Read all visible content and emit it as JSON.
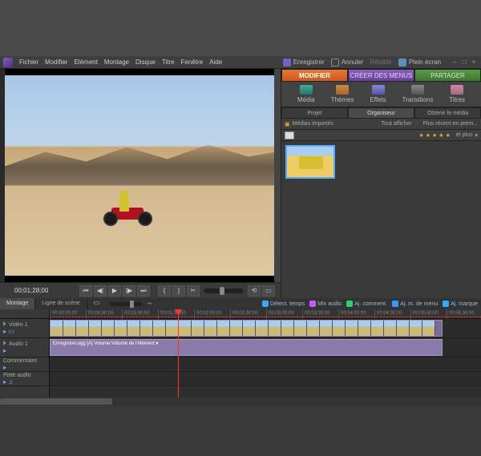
{
  "menu": {
    "items": [
      "Fichier",
      "Modifier",
      "Elément",
      "Montage",
      "Disque",
      "Titre",
      "Fenêtre",
      "Aide"
    ],
    "save": "Enregistrer",
    "undo": "Annuler",
    "redo": "Rétablir",
    "fullscreen": "Plein écran"
  },
  "preview": {
    "timecode": "00;01;28;00",
    "transport": {
      "prev": "⏮",
      "stepback": "◀|",
      "play": "▶",
      "stepfwd": "|▶",
      "next": "⏭",
      "in": "{",
      "out": "}",
      "split": "✂"
    }
  },
  "side": {
    "main_tabs": {
      "modify": "MODIFIER",
      "menus": "CRÉER DES MENUS",
      "share": "PARTAGER"
    },
    "tools": {
      "media": "Média",
      "themes": "Thèmes",
      "effects": "Effets",
      "transitions": "Transitions",
      "titles": "Titres"
    },
    "subtabs": {
      "project": "Projet",
      "organizer": "Organiseur",
      "get": "Obtenir le média"
    },
    "filter": {
      "imported": "Médias importés",
      "showall": "Tout afficher",
      "recent": "Plus récent en prem...",
      "more": "et plus"
    }
  },
  "timeline": {
    "tabs": {
      "montage": "Montage",
      "scene": "Ligne de scène"
    },
    "tools": {
      "detect": "Détect. temps",
      "mix": "Mix audio",
      "comment": "Aj. comment.",
      "menumark": "Aj. m. de menu",
      "marker": "Aj. marque"
    },
    "ruler": [
      "00;00;00;00",
      "00;00;30;00",
      "00;01;00;00",
      "00;01;30;00",
      "00;02;00;00",
      "00;02;30;00",
      "00;03;00;00",
      "00;03;30;00",
      "00;04;00;00",
      "00;04;30;00",
      "00;05;00;00",
      "00;05;30;00"
    ],
    "tracks": {
      "video": "Vidéo 1",
      "audio": "Audio 1",
      "comment": "Commentaire",
      "soundtrack": "Piste audio"
    },
    "audio_clip_label": "Enregistrer.ogg [A] Volume:Volume de l'élément ▾"
  }
}
